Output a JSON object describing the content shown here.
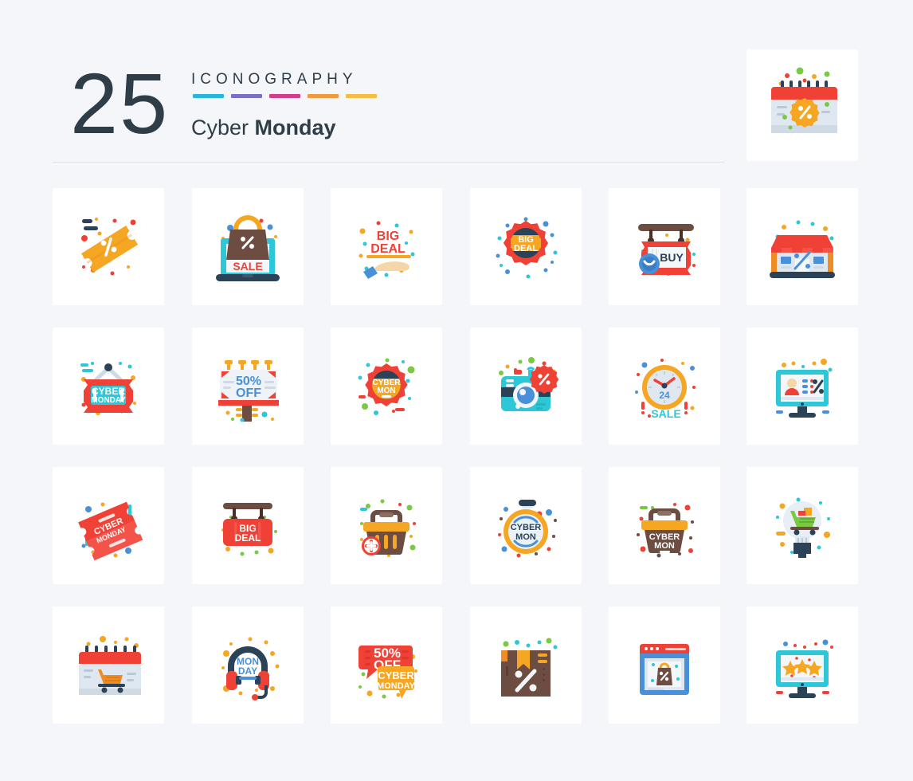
{
  "page": {
    "background_color": "#f4f6f9",
    "card_color": "#ffffff",
    "text_color": "#2f3d48"
  },
  "header": {
    "count": "25",
    "kicker": "ICONOGRAPHY",
    "title_light": "Cyber ",
    "title_bold": "Monday",
    "divider_colors": [
      "#29b6dd",
      "#7b6fc4",
      "#d33d8c",
      "#f0993e",
      "#f5bd42"
    ]
  },
  "featured": {
    "name": "calendar-discount-icon",
    "label": "Calendar with discount badge"
  },
  "grid": {
    "columns": 6,
    "rows": 4,
    "icons": [
      {
        "name": "discount-coupon-icon",
        "label": "Discount coupon ticket",
        "text": ""
      },
      {
        "name": "laptop-sale-bag-icon",
        "label": "Laptop with shopping bag",
        "text": "SALE"
      },
      {
        "name": "big-deal-hand-icon",
        "label": "Hand holding big deal",
        "text": "BIG DEAL"
      },
      {
        "name": "big-deal-badge-icon",
        "label": "Big deal rosette badge",
        "text": "BIG DEAL"
      },
      {
        "name": "buy-hanging-sign-icon",
        "label": "Buy hanging sign with clock",
        "text": "BUY"
      },
      {
        "name": "shop-storefront-icon",
        "label": "Shop storefront with discount",
        "text": ""
      },
      {
        "name": "cyber-monday-sign-icon",
        "label": "Cyber Monday hanging plaque",
        "text": "CYBER MONDAY"
      },
      {
        "name": "fifty-off-billboard-icon",
        "label": "50% off billboard",
        "text": "50% OFF"
      },
      {
        "name": "cyber-mon-badge-icon",
        "label": "Cyber Mon rosette badge",
        "text": "CYBER MON"
      },
      {
        "name": "camera-discount-icon",
        "label": "Camera with discount badge",
        "text": ""
      },
      {
        "name": "clock-24-sale-icon",
        "label": "24 hour sale clock",
        "text": "24 SALE"
      },
      {
        "name": "monitor-user-discount-icon",
        "label": "Monitor with user and discount",
        "text": ""
      },
      {
        "name": "cyber-monday-tickets-icon",
        "label": "Cyber Monday tickets",
        "text": "CYBER MONDAY"
      },
      {
        "name": "big-deal-hanging-sign-icon",
        "label": "Big Deal hanging board",
        "text": "BIG DEAL"
      },
      {
        "name": "add-to-basket-icon",
        "label": "Shopping basket with plus",
        "text": ""
      },
      {
        "name": "cyber-mon-stopwatch-icon",
        "label": "Cyber Mon stopwatch",
        "text": "CYBER MON"
      },
      {
        "name": "cyber-mon-basket-icon",
        "label": "Cyber Mon shopping basket",
        "text": "CYBER MON"
      },
      {
        "name": "shopping-idea-bulb-icon",
        "label": "Lightbulb with shopping cart",
        "text": ""
      },
      {
        "name": "calendar-cart-icon",
        "label": "Calendar with shopping cart",
        "text": ""
      },
      {
        "name": "monday-headset-icon",
        "label": "Support headset Monday",
        "text": "MON DAY"
      },
      {
        "name": "fifty-off-chat-icon",
        "label": "50% off chat bubbles",
        "text": "50% OFF CYBER MONDAY"
      },
      {
        "name": "discount-package-icon",
        "label": "Package box with discount",
        "text": ""
      },
      {
        "name": "online-shop-window-icon",
        "label": "Browser window with shopping bag",
        "text": ""
      },
      {
        "name": "monitor-rating-stars-icon",
        "label": "Monitor with star rating",
        "text": ""
      }
    ]
  },
  "palette": {
    "red": "#ef4136",
    "red_soft": "#f4534a",
    "orange": "#f5a623",
    "orange_dark": "#ef8d22",
    "yellow": "#f7c53f",
    "cyan": "#2ec7d8",
    "blue": "#4a90d9",
    "navy": "#2b4257",
    "brown": "#6d4c41",
    "green": "#7ac943",
    "light_blue": "#dfe8f0"
  }
}
